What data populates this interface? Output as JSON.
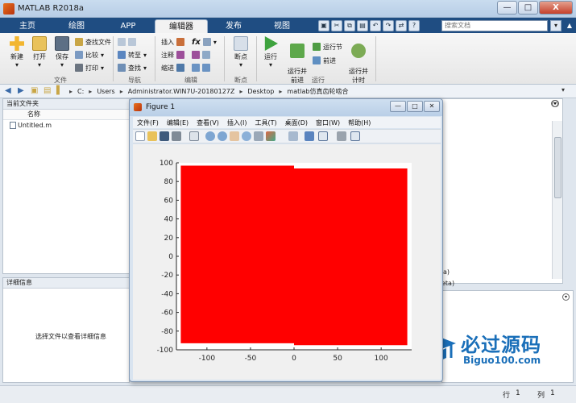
{
  "window": {
    "title": "MATLAB R2018a",
    "minimize": "—",
    "maximize": "□",
    "close": "X"
  },
  "tabs": [
    "主页",
    "绘图",
    "APP",
    "编辑器",
    "发布",
    "视图"
  ],
  "search": {
    "placeholder": "搜索文档",
    "btn": "▾"
  },
  "ribbon": {
    "file": {
      "new": "新建",
      "open": "打开",
      "save": "保存",
      "find_files": "查找文件",
      "compare": "比较",
      "print": "打印",
      "group": "文件"
    },
    "nav": {
      "goto": "转至",
      "find": "查找",
      "group": "导航"
    },
    "edit": {
      "insert": "插入",
      "comment": "注释",
      "indent": "缩进",
      "fx": "fx",
      "group": "编辑"
    },
    "breakpoints": {
      "label": "断点",
      "group": "断点"
    },
    "run": {
      "run": "运行",
      "run_advance": "运行并\n前进",
      "run_section": "运行节",
      "advance": "前进",
      "run_time": "运行并\n计时",
      "group": "运行"
    }
  },
  "address": {
    "parts": [
      "C:",
      "Users",
      "Administrator.WIN7U-20180127Z",
      "Desktop",
      "matlab仿真齿轮啮合"
    ]
  },
  "current_folder": {
    "title": "当前文件夹",
    "col_name": "名称",
    "files": [
      "Untitled.m"
    ]
  },
  "details": {
    "title": "详细信息",
    "message": "选择文件以查看详细信息"
  },
  "command_fragments": [
    "a)",
    "eta)"
  ],
  "statusbar": {
    "row_label": "行",
    "row": "1",
    "col_label": "列",
    "col": "1"
  },
  "watermark": {
    "title": "必过源码",
    "sub": "Biguo100.com"
  },
  "figure": {
    "title": "Figure 1",
    "menu": [
      "文件(F)",
      "编辑(E)",
      "查看(V)",
      "插入(I)",
      "工具(T)",
      "桌面(D)",
      "窗口(W)",
      "帮助(H)"
    ]
  },
  "chart_data": {
    "type": "area",
    "title": "",
    "xlabel": "",
    "ylabel": "",
    "xlim": [
      -135,
      135
    ],
    "ylim": [
      -100,
      100
    ],
    "xticks": [
      -100,
      -50,
      0,
      50,
      100
    ],
    "yticks": [
      -100,
      -80,
      -60,
      -40,
      -20,
      0,
      20,
      40,
      60,
      80,
      100
    ],
    "fill_color": "#ff0000",
    "series": [
      {
        "x": [
          -130,
          0
        ],
        "upper": [
          97,
          97
        ],
        "lower": [
          -93,
          -93
        ]
      },
      {
        "x": [
          0,
          130
        ],
        "upper": [
          94,
          94
        ],
        "lower": [
          -95,
          -95
        ]
      }
    ]
  },
  "colors": {
    "tab_bar": "#1f4d82",
    "figure_fill": "#ff0000"
  }
}
